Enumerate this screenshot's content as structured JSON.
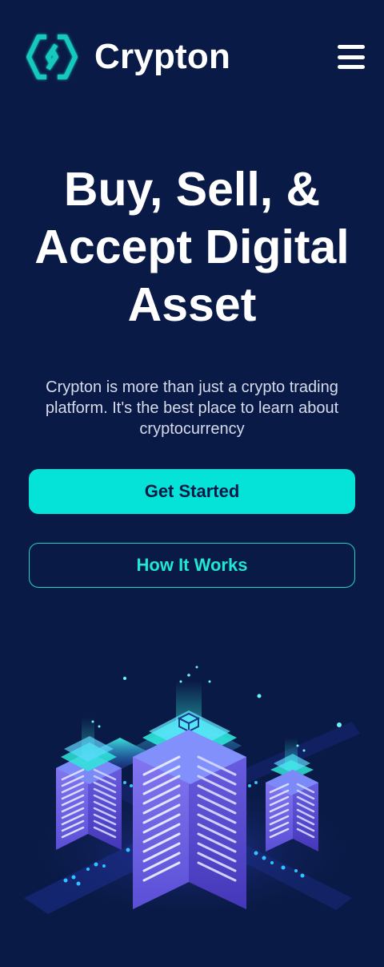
{
  "header": {
    "brand_name": "Crypton",
    "logo_icon": "crypton-logo-icon",
    "menu_icon": "hamburger-menu-icon"
  },
  "hero": {
    "title": "Buy, Sell, & Accept Digital Asset",
    "description": "Crypton is more than just a crypto trading platform. It's the best place to learn about cryptocurrency"
  },
  "buttons": {
    "primary_label": "Get Started",
    "secondary_label": "How It Works"
  },
  "colors": {
    "background": "#0a1a46",
    "accent": "#05e3d8",
    "text": "#ffffff",
    "muted_text": "#d7dbeb"
  },
  "illustration": {
    "icon": "blockchain-servers-illustration"
  }
}
